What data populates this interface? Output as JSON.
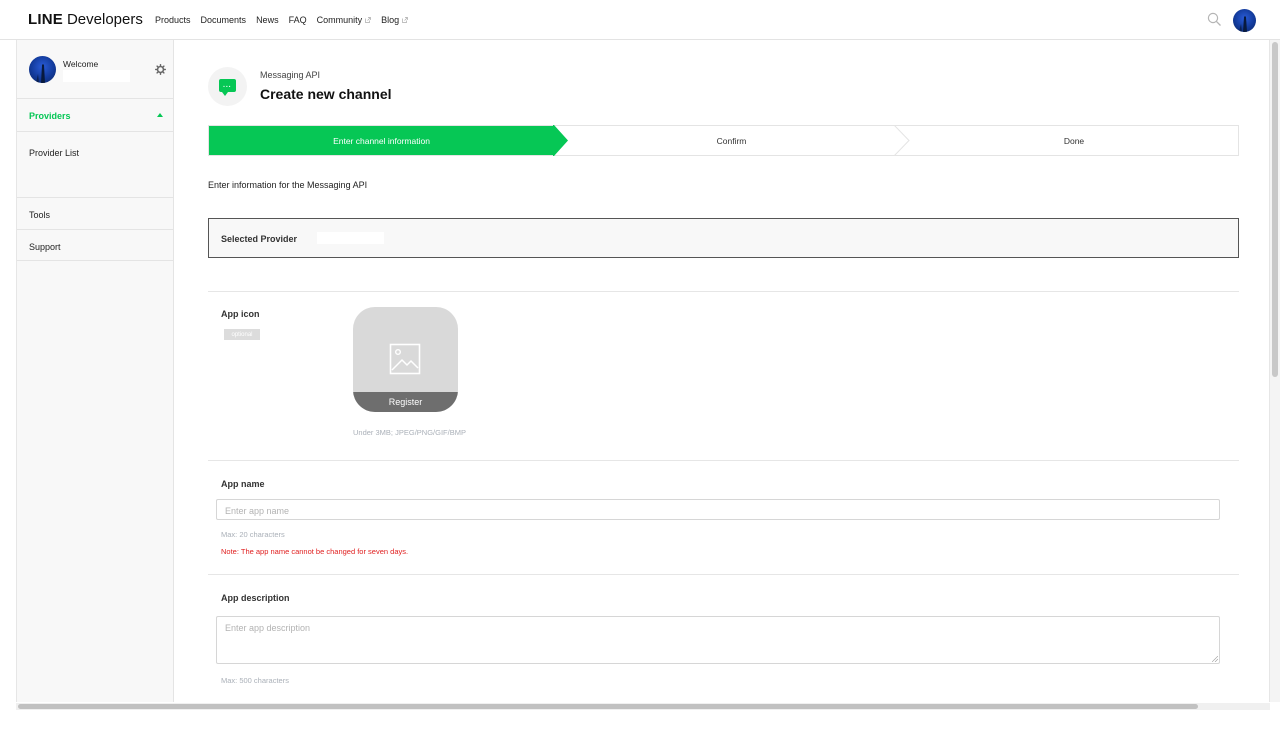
{
  "header": {
    "logo_line": "LINE",
    "logo_dev": "Developers",
    "nav": [
      {
        "label": "Products",
        "external": false
      },
      {
        "label": "Documents",
        "external": false
      },
      {
        "label": "News",
        "external": false
      },
      {
        "label": "FAQ",
        "external": false
      },
      {
        "label": "Community",
        "external": true
      },
      {
        "label": "Blog",
        "external": true
      }
    ],
    "search_icon": "search-icon",
    "avatar_icon": "avatar"
  },
  "sidebar": {
    "welcome": "Welcome",
    "user_name": "",
    "settings_icon": "gear-icon",
    "providers": "Providers",
    "provider_list": "Provider List",
    "tools": "Tools",
    "support": "Support"
  },
  "main": {
    "breadcrumb": "Messaging API",
    "title": "Create new channel",
    "steps": [
      {
        "label": "Enter channel information",
        "active": true
      },
      {
        "label": "Confirm",
        "active": false
      },
      {
        "label": "Done",
        "active": false
      }
    ],
    "intro": "Enter information for the Messaging API",
    "selected_provider_label": "Selected Provider",
    "selected_provider_value": "",
    "app_icon": {
      "label": "App icon",
      "badge": "optional",
      "register": "Register",
      "hint": "Under 3MB; JPEG/PNG/GIF/BMP"
    },
    "app_name": {
      "label": "App name",
      "placeholder": "Enter app name",
      "hint": "Max: 20 characters",
      "warning": "Note: The app name cannot be changed for seven days."
    },
    "app_description": {
      "label": "App description",
      "placeholder": "Enter app description",
      "hint": "Max: 500 characters"
    }
  },
  "colors": {
    "brand_green": "#06c755",
    "warning_red": "#e02020"
  }
}
